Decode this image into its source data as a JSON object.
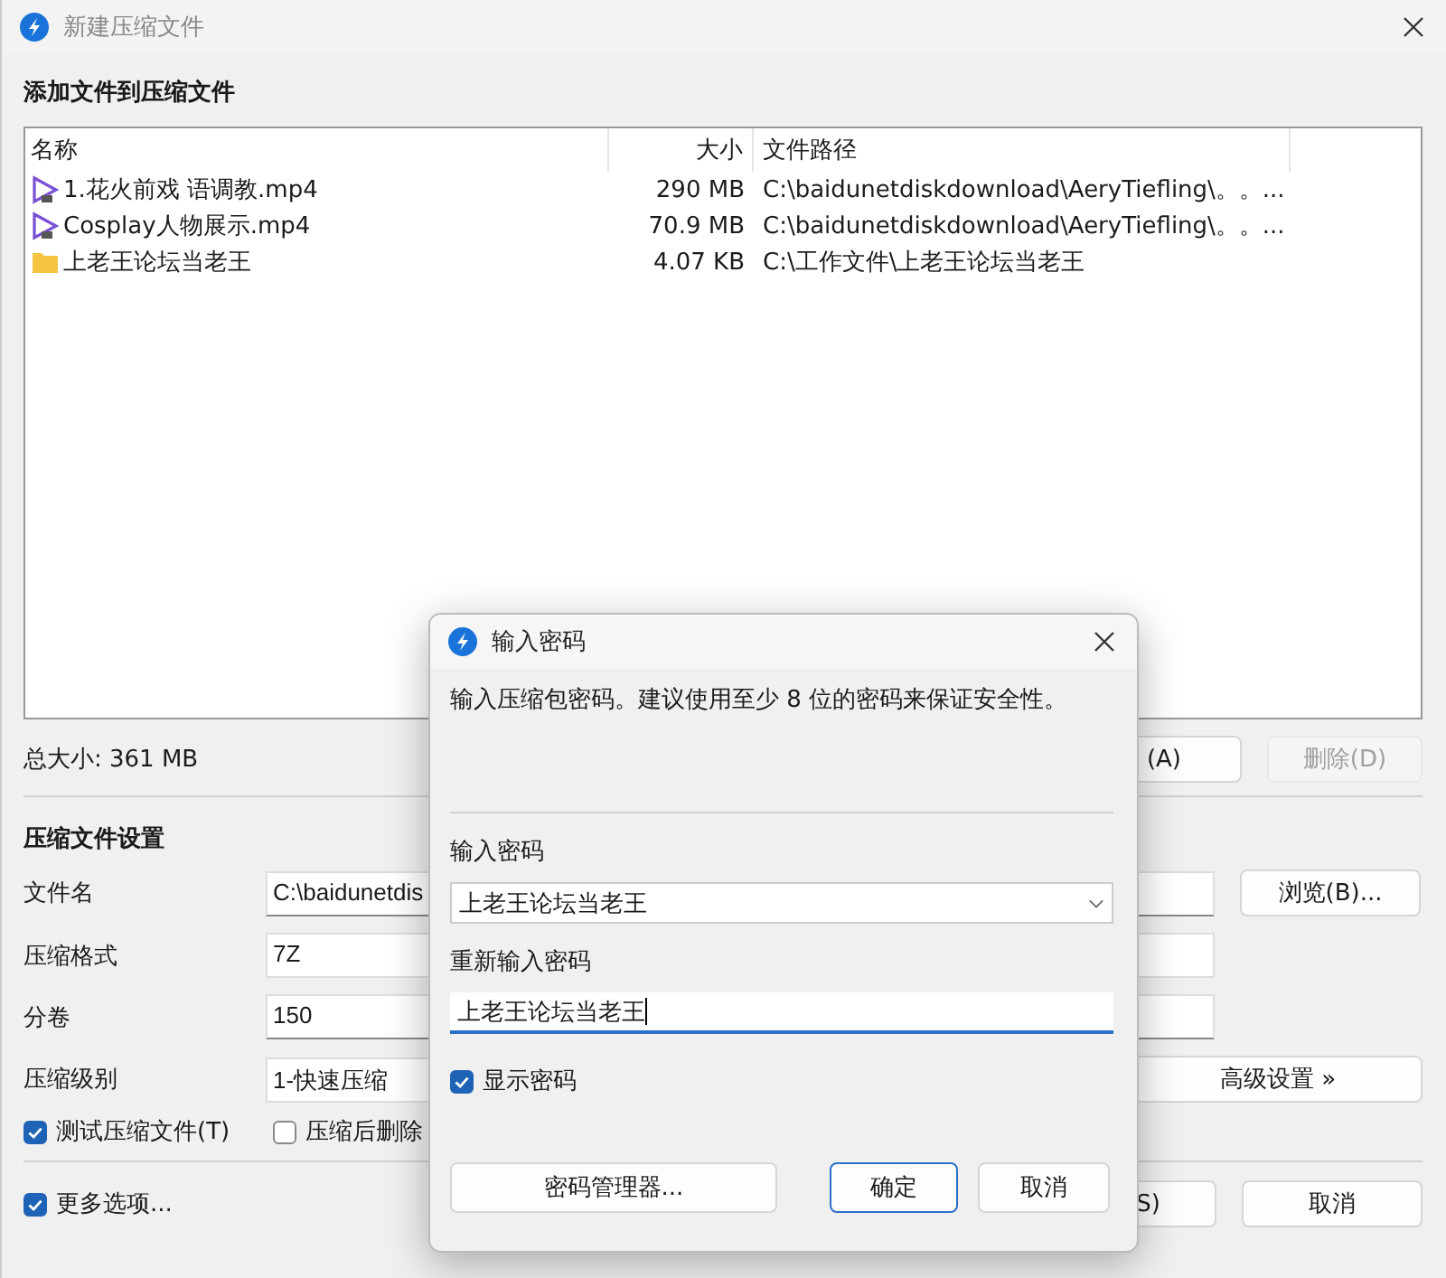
{
  "window": {
    "title": "新建压缩文件"
  },
  "heading": "添加文件到压缩文件",
  "file_list": {
    "columns": [
      "名称",
      "大小",
      "文件路径"
    ],
    "rows": [
      {
        "kind": "video",
        "name": "1.花火前戏 语调教.mp4",
        "size": "290 MB",
        "path": "C:\\baidunetdiskdownload\\AeryTiefling\\。。..."
      },
      {
        "kind": "video",
        "name": "Cosplay人物展示.mp4",
        "size": "70.9 MB",
        "path": "C:\\baidunetdiskdownload\\AeryTiefling\\。。..."
      },
      {
        "kind": "folder",
        "name": "上老王论坛当老王",
        "size": "4.07 KB",
        "path": "C:\\工作文件\\上老王论坛当老王"
      }
    ]
  },
  "total_size": "总大小: 361 MB",
  "list_buttons": [
    {
      "label": "(A)",
      "disabled": false
    },
    {
      "label": "删除(D)",
      "disabled": true
    }
  ],
  "settings": {
    "heading": "压缩文件设置",
    "fields": [
      {
        "label": "文件名",
        "value": "C:\\baidunetdis",
        "kind": "text"
      },
      {
        "label": "压缩格式",
        "value": "7Z",
        "kind": "dropdown"
      },
      {
        "label": "分卷",
        "value": "150",
        "kind": "text"
      },
      {
        "label": "压缩级别",
        "value": "1-快速压缩",
        "kind": "dropdown"
      }
    ],
    "browse_button": "浏览(B)...",
    "advanced_button": "高级设置 »",
    "options": [
      {
        "label": "测试压缩文件(T)",
        "checked": true
      },
      {
        "label": "压缩后删除",
        "checked": false
      }
    ]
  },
  "more_options": {
    "label": "更多选项...",
    "checked": true
  },
  "bottom_buttons": [
    "S)",
    "取消"
  ],
  "dialog": {
    "title": "输入密码",
    "message": "输入压缩包密码。建议使用至少 8 位的密码来保证安全性。",
    "password_label": "输入密码",
    "password": "上老王论坛当老王",
    "confirm_label": "重新输入密码",
    "confirm": "上老王论坛当老王",
    "show_password": {
      "label": "显示密码",
      "checked": true
    },
    "buttons": [
      {
        "label": "密码管理器...",
        "default": false
      },
      {
        "label": "确定",
        "default": true
      },
      {
        "label": "取消",
        "default": false
      }
    ]
  }
}
